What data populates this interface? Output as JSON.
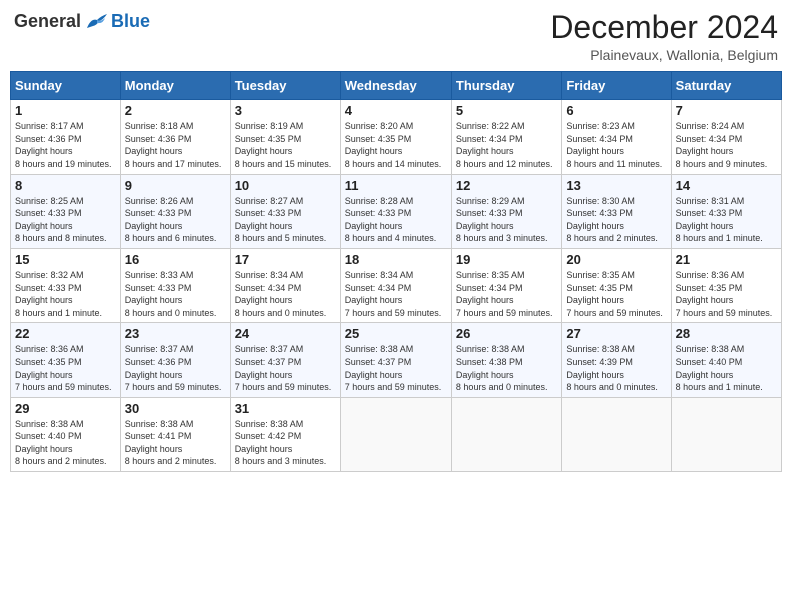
{
  "logo": {
    "general": "General",
    "blue": "Blue"
  },
  "title": "December 2024",
  "location": "Plainevaux, Wallonia, Belgium",
  "weekdays": [
    "Sunday",
    "Monday",
    "Tuesday",
    "Wednesday",
    "Thursday",
    "Friday",
    "Saturday"
  ],
  "weeks": [
    [
      {
        "day": "1",
        "sunrise": "8:17 AM",
        "sunset": "4:36 PM",
        "daylight": "8 hours and 19 minutes."
      },
      {
        "day": "2",
        "sunrise": "8:18 AM",
        "sunset": "4:36 PM",
        "daylight": "8 hours and 17 minutes."
      },
      {
        "day": "3",
        "sunrise": "8:19 AM",
        "sunset": "4:35 PM",
        "daylight": "8 hours and 15 minutes."
      },
      {
        "day": "4",
        "sunrise": "8:20 AM",
        "sunset": "4:35 PM",
        "daylight": "8 hours and 14 minutes."
      },
      {
        "day": "5",
        "sunrise": "8:22 AM",
        "sunset": "4:34 PM",
        "daylight": "8 hours and 12 minutes."
      },
      {
        "day": "6",
        "sunrise": "8:23 AM",
        "sunset": "4:34 PM",
        "daylight": "8 hours and 11 minutes."
      },
      {
        "day": "7",
        "sunrise": "8:24 AM",
        "sunset": "4:34 PM",
        "daylight": "8 hours and 9 minutes."
      }
    ],
    [
      {
        "day": "8",
        "sunrise": "8:25 AM",
        "sunset": "4:33 PM",
        "daylight": "8 hours and 8 minutes."
      },
      {
        "day": "9",
        "sunrise": "8:26 AM",
        "sunset": "4:33 PM",
        "daylight": "8 hours and 6 minutes."
      },
      {
        "day": "10",
        "sunrise": "8:27 AM",
        "sunset": "4:33 PM",
        "daylight": "8 hours and 5 minutes."
      },
      {
        "day": "11",
        "sunrise": "8:28 AM",
        "sunset": "4:33 PM",
        "daylight": "8 hours and 4 minutes."
      },
      {
        "day": "12",
        "sunrise": "8:29 AM",
        "sunset": "4:33 PM",
        "daylight": "8 hours and 3 minutes."
      },
      {
        "day": "13",
        "sunrise": "8:30 AM",
        "sunset": "4:33 PM",
        "daylight": "8 hours and 2 minutes."
      },
      {
        "day": "14",
        "sunrise": "8:31 AM",
        "sunset": "4:33 PM",
        "daylight": "8 hours and 1 minute."
      }
    ],
    [
      {
        "day": "15",
        "sunrise": "8:32 AM",
        "sunset": "4:33 PM",
        "daylight": "8 hours and 1 minute."
      },
      {
        "day": "16",
        "sunrise": "8:33 AM",
        "sunset": "4:33 PM",
        "daylight": "8 hours and 0 minutes."
      },
      {
        "day": "17",
        "sunrise": "8:34 AM",
        "sunset": "4:34 PM",
        "daylight": "8 hours and 0 minutes."
      },
      {
        "day": "18",
        "sunrise": "8:34 AM",
        "sunset": "4:34 PM",
        "daylight": "7 hours and 59 minutes."
      },
      {
        "day": "19",
        "sunrise": "8:35 AM",
        "sunset": "4:34 PM",
        "daylight": "7 hours and 59 minutes."
      },
      {
        "day": "20",
        "sunrise": "8:35 AM",
        "sunset": "4:35 PM",
        "daylight": "7 hours and 59 minutes."
      },
      {
        "day": "21",
        "sunrise": "8:36 AM",
        "sunset": "4:35 PM",
        "daylight": "7 hours and 59 minutes."
      }
    ],
    [
      {
        "day": "22",
        "sunrise": "8:36 AM",
        "sunset": "4:35 PM",
        "daylight": "7 hours and 59 minutes."
      },
      {
        "day": "23",
        "sunrise": "8:37 AM",
        "sunset": "4:36 PM",
        "daylight": "7 hours and 59 minutes."
      },
      {
        "day": "24",
        "sunrise": "8:37 AM",
        "sunset": "4:37 PM",
        "daylight": "7 hours and 59 minutes."
      },
      {
        "day": "25",
        "sunrise": "8:38 AM",
        "sunset": "4:37 PM",
        "daylight": "7 hours and 59 minutes."
      },
      {
        "day": "26",
        "sunrise": "8:38 AM",
        "sunset": "4:38 PM",
        "daylight": "8 hours and 0 minutes."
      },
      {
        "day": "27",
        "sunrise": "8:38 AM",
        "sunset": "4:39 PM",
        "daylight": "8 hours and 0 minutes."
      },
      {
        "day": "28",
        "sunrise": "8:38 AM",
        "sunset": "4:40 PM",
        "daylight": "8 hours and 1 minute."
      }
    ],
    [
      {
        "day": "29",
        "sunrise": "8:38 AM",
        "sunset": "4:40 PM",
        "daylight": "8 hours and 2 minutes."
      },
      {
        "day": "30",
        "sunrise": "8:38 AM",
        "sunset": "4:41 PM",
        "daylight": "8 hours and 2 minutes."
      },
      {
        "day": "31",
        "sunrise": "8:38 AM",
        "sunset": "4:42 PM",
        "daylight": "8 hours and 3 minutes."
      },
      null,
      null,
      null,
      null
    ]
  ]
}
